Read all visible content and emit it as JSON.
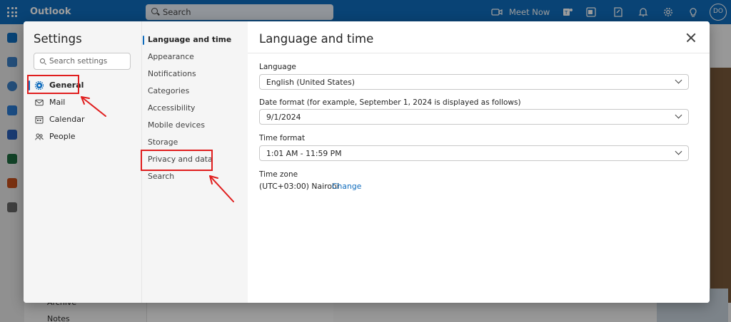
{
  "app": {
    "name": "Outlook"
  },
  "topbar": {
    "search_placeholder": "Search",
    "meet_now_label": "Meet Now",
    "avatar_initials": "DO",
    "icons": [
      "waffle-icon",
      "video-icon",
      "teams-icon",
      "onenote-icon",
      "note-icon",
      "bell-icon",
      "gear-icon",
      "lightbulb-icon"
    ]
  },
  "background": {
    "items": [
      "Archive",
      "Notes"
    ]
  },
  "settings": {
    "title": "Settings",
    "search_placeholder": "Search settings",
    "categories": [
      {
        "label": "General",
        "icon": "gear-icon",
        "active": true
      },
      {
        "label": "Mail",
        "icon": "mail-icon",
        "active": false
      },
      {
        "label": "Calendar",
        "icon": "calendar-icon",
        "active": false
      },
      {
        "label": "People",
        "icon": "people-icon",
        "active": false
      }
    ],
    "subcategories": [
      {
        "label": "Language and time",
        "active": true
      },
      {
        "label": "Appearance",
        "active": false
      },
      {
        "label": "Notifications",
        "active": false
      },
      {
        "label": "Categories",
        "active": false
      },
      {
        "label": "Accessibility",
        "active": false
      },
      {
        "label": "Mobile devices",
        "active": false
      },
      {
        "label": "Storage",
        "active": false
      },
      {
        "label": "Privacy and data",
        "active": false
      },
      {
        "label": "Search",
        "active": false
      }
    ],
    "pane": {
      "title": "Language and time",
      "language": {
        "label": "Language",
        "value": "English (United States)"
      },
      "date_format": {
        "label": "Date format (for example, September 1, 2024 is displayed as follows)",
        "value": "9/1/2024"
      },
      "time_format": {
        "label": "Time format",
        "value": "1:01 AM - 11:59 PM"
      },
      "time_zone": {
        "label": "Time zone",
        "value": "(UTC+03:00) Nairobi",
        "change_link": "Change"
      }
    }
  },
  "colors": {
    "brand": "#0f6cbd",
    "highlight": "#e01e1e"
  }
}
